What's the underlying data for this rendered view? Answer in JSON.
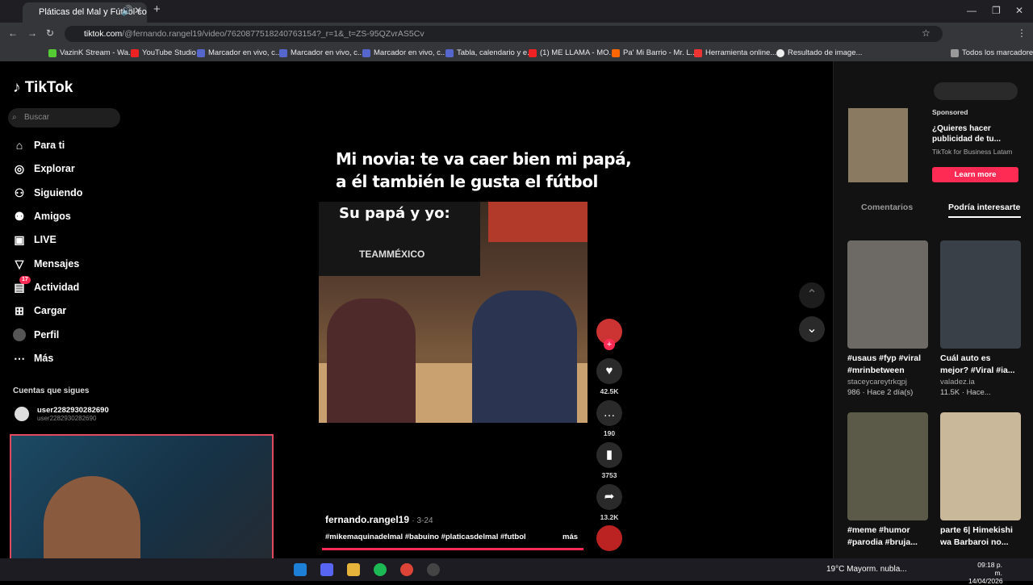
{
  "browser": {
    "tab_title": "Pláticas del Mal y Fútbol co...",
    "url_host": "tiktok.com",
    "url_path": "/@fernando.rangel19/video/7620877518240763154?_r=1&_t=ZS-95QZvrAS5Cv",
    "bookmarks": [
      "VazinK Stream - Wa...",
      "YouTube Studio",
      "Marcador en vivo, c...",
      "Marcador en vivo, c...",
      "Marcador en vivo, c...",
      "Tabla, calendario y e...",
      "(1) ME LLAMA - MO...",
      "Pa' Mi Barrio - Mr. L...",
      "Herramienta online...",
      "Resultado de image..."
    ],
    "all_bookmarks": "Todos los marcadores"
  },
  "app": {
    "logo": "TikTok",
    "search_placeholder": "Buscar",
    "nav": [
      "Para ti",
      "Explorar",
      "Siguiendo",
      "Amigos",
      "LIVE",
      "Mensajes",
      "Actividad",
      "Cargar",
      "Perfil",
      "Más"
    ],
    "activity_badge": "17",
    "following_heading": "Cuentas que sigues",
    "account_name": "user2282930282690",
    "account_handle": "user2282930282690"
  },
  "video": {
    "caption_line1": "Mi novia: te va caer bien mi papá,",
    "caption_line2": "a él también le gusta el fútbol",
    "overlay": "Su papá y yo:",
    "sign_text": "TEAMMÉXICO",
    "author": "fernando.rangel19",
    "date": "3-24",
    "hashtags": "#mikemaquinadelmal #babuino #platicasdelmal #futbol",
    "more": "más",
    "likes": "42.5K",
    "comments": "190",
    "saves": "3753",
    "shares": "13.2K"
  },
  "ad": {
    "sponsored": "Sponsored",
    "title": "¿Quieres hacer publicidad de tu...",
    "advertiser": "TikTok for Business Latam",
    "cta": "Learn more"
  },
  "tabs": {
    "comments": "Comentarios",
    "suggested": "Podría interesarte"
  },
  "cards": [
    {
      "title": "#usaus #fyp #viral #mrinbetween",
      "user": "staceycareytrkqpj",
      "meta": "986 · Hace 2 día(s)",
      "color": "#6d6a66"
    },
    {
      "title": "Cuál auto es mejor? #Viral #ia...",
      "user": "valadez.ia",
      "meta": "11.5K · Hace...",
      "color": "#3a4048"
    },
    {
      "title": "#meme #humor #parodia #bruja...",
      "user": "",
      "meta": "",
      "color": "#5b5a48"
    },
    {
      "title": "parte 6| Himekishi wa Barbaroi no...",
      "user": "",
      "meta": "",
      "color": "#c9b89a"
    }
  ],
  "taskbar": {
    "weather": "19°C  Mayorm. nubla...",
    "time": "09:18 p. m.",
    "date": "14/04/2026"
  }
}
